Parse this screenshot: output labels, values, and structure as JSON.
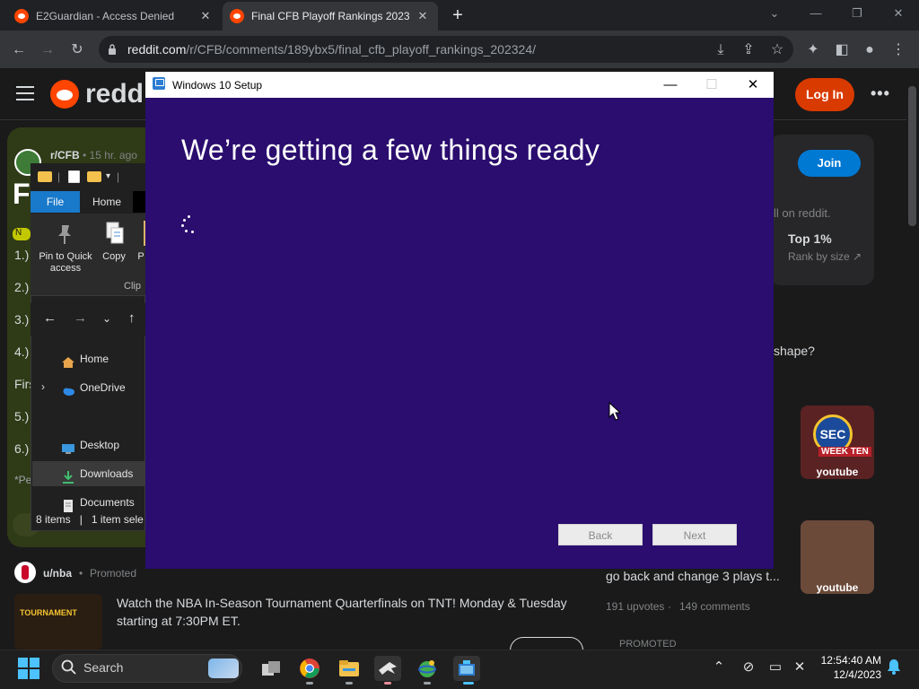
{
  "browser": {
    "tabs": [
      {
        "title": "E2Guardian - Access Denied",
        "close": "✕"
      },
      {
        "title": "Final CFB Playoff Rankings 2023",
        "close": "✕"
      }
    ],
    "new_tab": "+",
    "url_host": "reddit.com",
    "url_path": "/r/CFB/comments/189ybx5/final_cfb_playoff_rankings_202324/"
  },
  "reddit": {
    "brand": "reddit",
    "login_label": "Log In",
    "more": "•••",
    "post": {
      "subreddit": "r/CFB",
      "time": "• 15 hr. ago",
      "title_fragment": "F",
      "flair": "N",
      "rank_lines": [
        "1.)",
        "2.)",
        "3.)",
        "4.)",
        "Firs",
        "5.)",
        "6.)",
        "*Pe"
      ]
    },
    "sidebar": {
      "join_label": "Join",
      "fragment": "ll on reddit.",
      "top_pct": "Top 1%",
      "rank_size": "Rank by size",
      "question": "shape?",
      "videos": [
        {
          "label": "youtube",
          "logo": "SEC",
          "overlay": "WEEK TEN"
        },
        {
          "label": "youtube"
        }
      ]
    },
    "related": {
      "title": "go back and change 3 plays t...",
      "upvotes": "191 upvotes",
      "comments": "149 comments",
      "promoted": "PROMOTED"
    },
    "ad": {
      "user": "u/nba",
      "promoted": "Promoted",
      "text": "Watch the NBA In-Season Tournament Quarterfinals on TNT! Monday & Tuesday starting at 7:30PM ET.",
      "thumb_text": "TOURNAMENT"
    }
  },
  "explorer": {
    "file_tab": "File",
    "home_tab": "Home",
    "ribbon": [
      {
        "label": "Pin to Quick access",
        "icon": "pin-icon"
      },
      {
        "label": "Copy",
        "icon": "copy-icon"
      },
      {
        "label": "P",
        "icon": "paste-icon"
      }
    ],
    "ribbon_group": "Clip",
    "tree": [
      {
        "label": "Home",
        "icon": "home-icon"
      },
      {
        "label": "OneDrive",
        "icon": "cloud-icon"
      },
      {
        "label": "Desktop",
        "icon": "desktop-icon"
      },
      {
        "label": "Downloads",
        "icon": "download-icon"
      },
      {
        "label": "Documents",
        "icon": "documents-icon"
      }
    ],
    "status_count": "8 items",
    "status_sel": "1 item sele"
  },
  "setup": {
    "window_title": "Windows 10 Setup",
    "heading": "We’re getting a few things ready",
    "back_label": "Back",
    "next_label": "Next",
    "bg_color": "#2a0d6e"
  },
  "taskbar": {
    "search_label": "Search",
    "time": "12:54:40 AM",
    "date": "12/4/2023"
  },
  "colors": {
    "reddit_orange": "#ff4500",
    "login_red": "#d93a00",
    "join_blue": "#0079d3",
    "explorer_file_blue": "#1979ca",
    "windows_accent": "#4cc2ff"
  }
}
